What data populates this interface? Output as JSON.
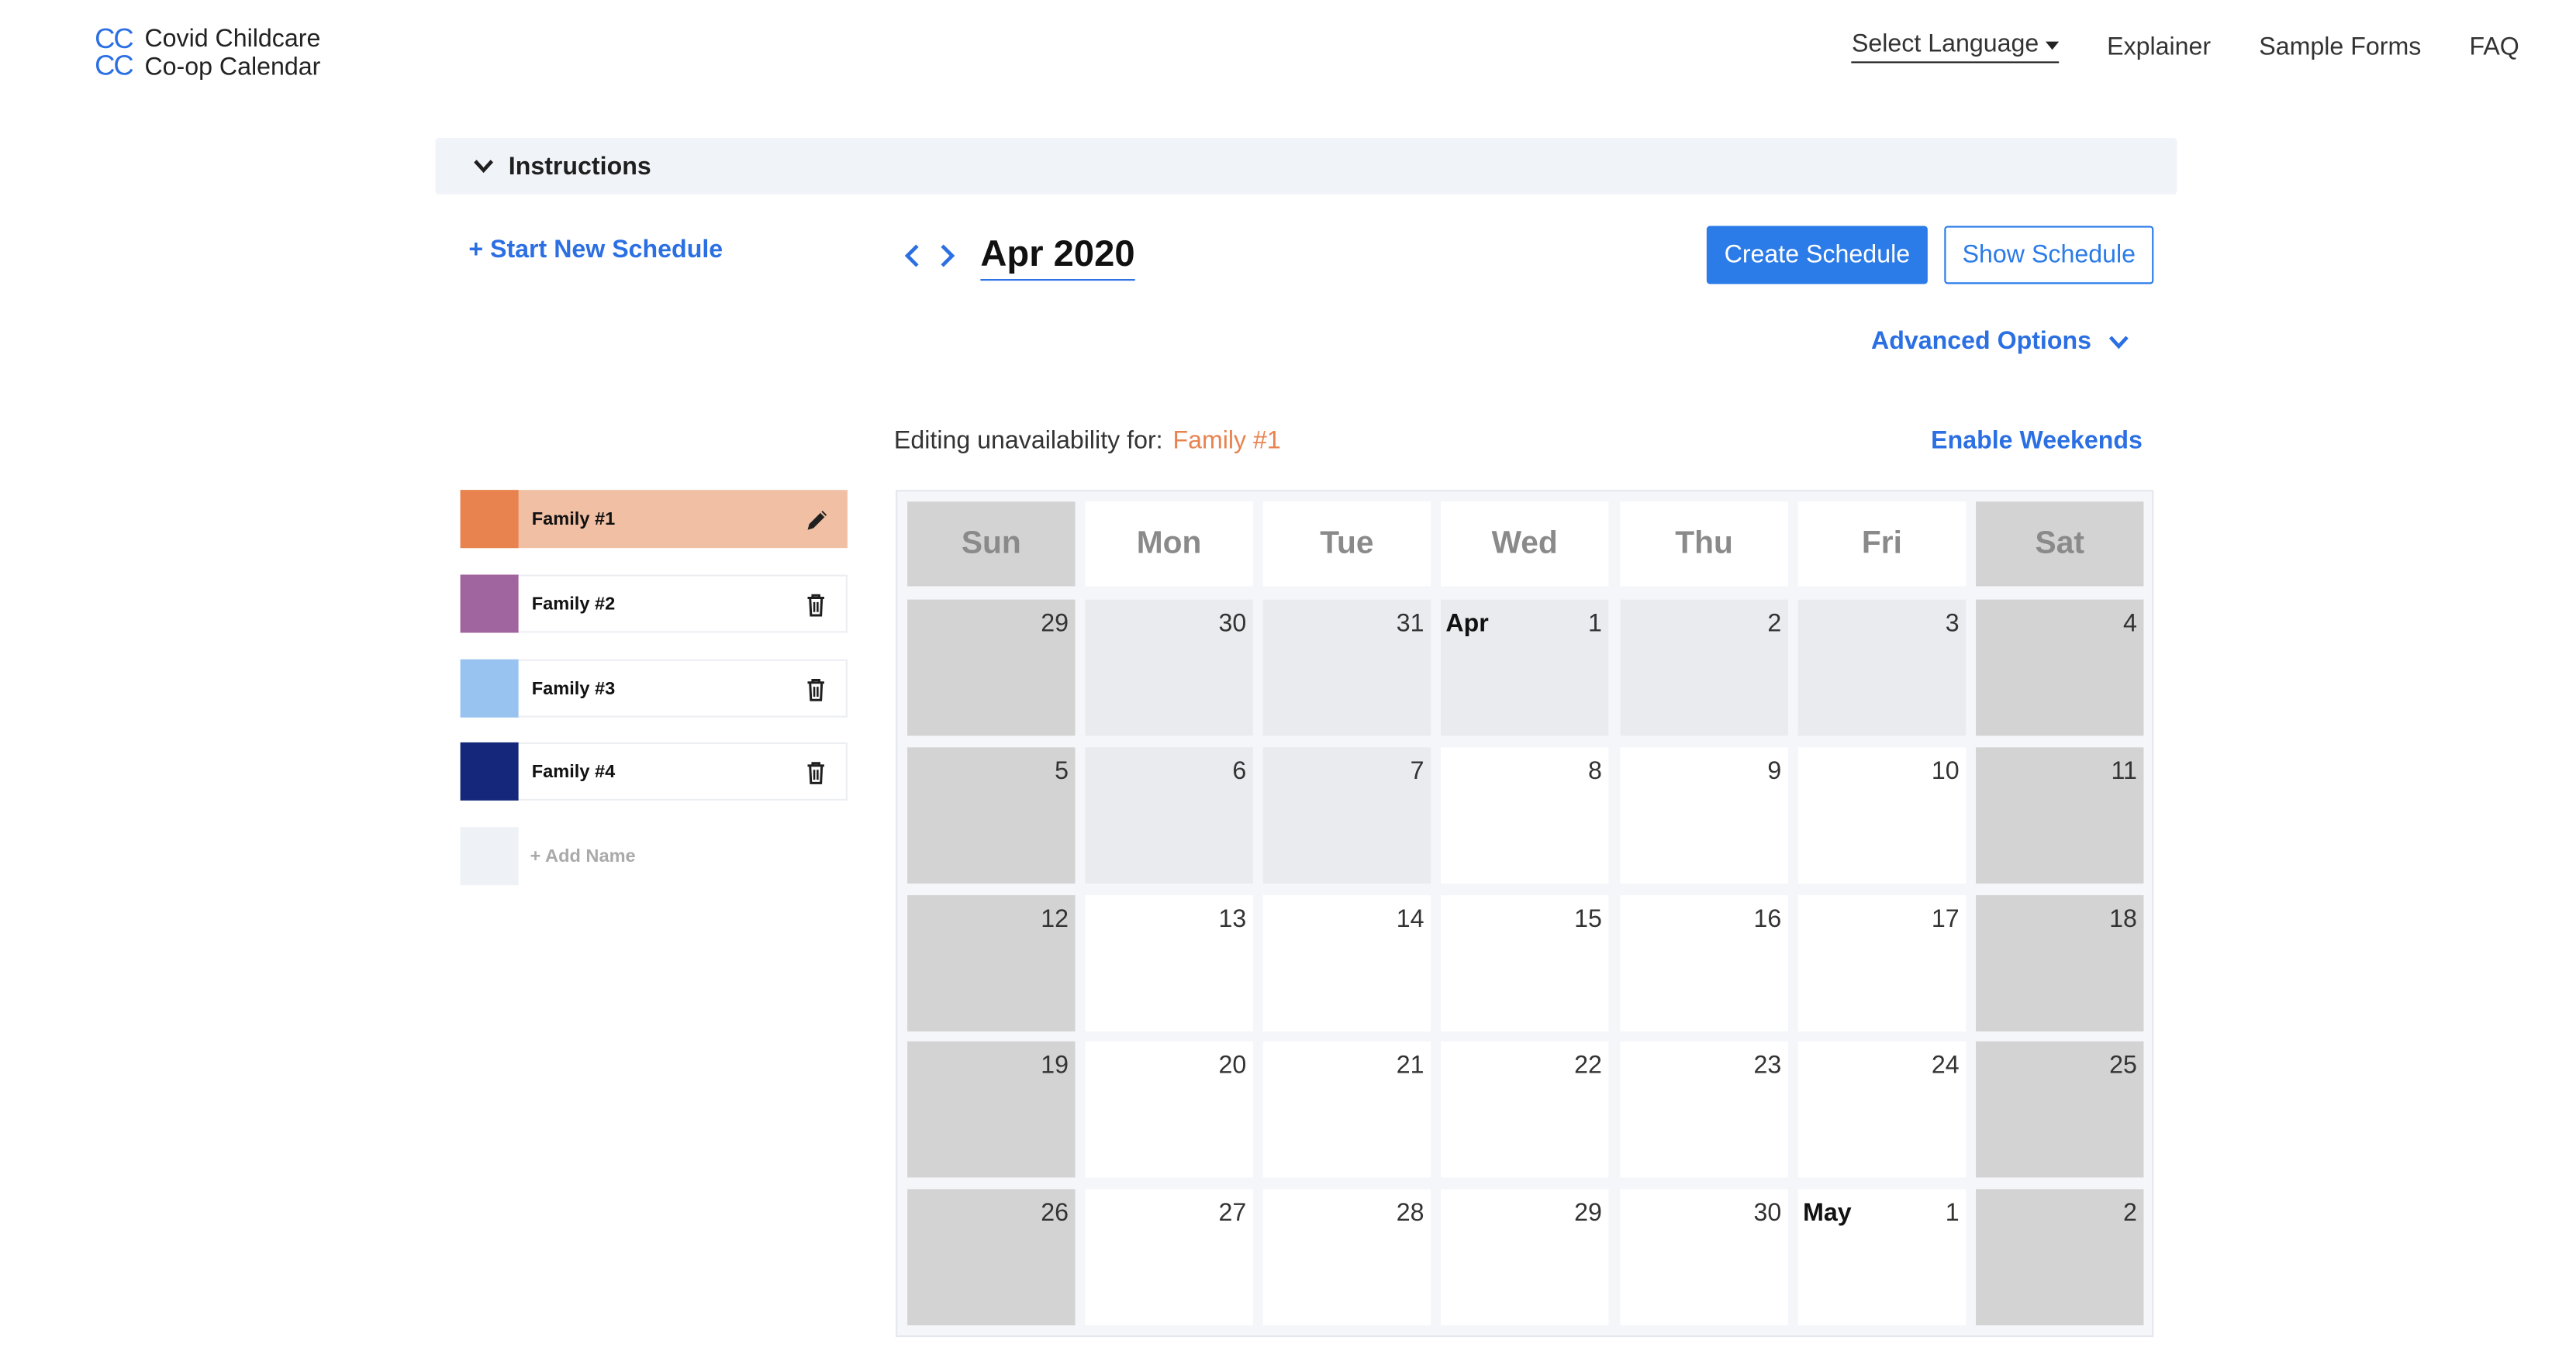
{
  "header": {
    "logo_mark_top": "CC",
    "logo_mark_bottom": "CC",
    "logo_line1": "Covid Childcare",
    "logo_line2": "Co-op Calendar",
    "nav": {
      "language": "Select Language",
      "explainer": "Explainer",
      "sample_forms": "Sample Forms",
      "faq": "FAQ"
    }
  },
  "instructions": {
    "label": "Instructions"
  },
  "toolbar": {
    "start_new": "+ Start New Schedule",
    "month_title": "Apr 2020",
    "create_schedule": "Create Schedule",
    "show_schedule": "Show Schedule",
    "advanced_options": "Advanced Options"
  },
  "editing": {
    "prefix": "Editing unavailability for:",
    "family": "Family #1",
    "enable_weekends": "Enable Weekends"
  },
  "families": [
    {
      "name": "Family #1",
      "color": "#e8834f",
      "row_color": "#f1bfa4",
      "selected": true,
      "icon": "pencil-icon"
    },
    {
      "name": "Family #2",
      "color": "#a0649e",
      "selected": false,
      "icon": "trash-icon"
    },
    {
      "name": "Family #3",
      "color": "#98c3f0",
      "selected": false,
      "icon": "trash-icon"
    },
    {
      "name": "Family #4",
      "color": "#15277a",
      "selected": false,
      "icon": "trash-icon"
    }
  ],
  "add_name": "+ Add Name",
  "calendar": {
    "day_headers": [
      "Sun",
      "Mon",
      "Tue",
      "Wed",
      "Thu",
      "Fri",
      "Sat"
    ],
    "weeks": [
      [
        {
          "d": "29",
          "s": "wk"
        },
        {
          "d": "30",
          "s": "un"
        },
        {
          "d": "31",
          "s": "un"
        },
        {
          "d": "1",
          "m": "Apr",
          "s": "un"
        },
        {
          "d": "2",
          "s": "un"
        },
        {
          "d": "3",
          "s": "un"
        },
        {
          "d": "4",
          "s": "wk"
        }
      ],
      [
        {
          "d": "5",
          "s": "wk"
        },
        {
          "d": "6",
          "s": "un"
        },
        {
          "d": "7",
          "s": "un"
        },
        {
          "d": "8",
          "s": "av"
        },
        {
          "d": "9",
          "s": "av"
        },
        {
          "d": "10",
          "s": "av"
        },
        {
          "d": "11",
          "s": "wk"
        }
      ],
      [
        {
          "d": "12",
          "s": "wk"
        },
        {
          "d": "13",
          "s": "av"
        },
        {
          "d": "14",
          "s": "av"
        },
        {
          "d": "15",
          "s": "av"
        },
        {
          "d": "16",
          "s": "av"
        },
        {
          "d": "17",
          "s": "av"
        },
        {
          "d": "18",
          "s": "wk"
        }
      ],
      [
        {
          "d": "19",
          "s": "wk"
        },
        {
          "d": "20",
          "s": "av"
        },
        {
          "d": "21",
          "s": "av"
        },
        {
          "d": "22",
          "s": "av"
        },
        {
          "d": "23",
          "s": "av"
        },
        {
          "d": "24",
          "s": "av"
        },
        {
          "d": "25",
          "s": "wk"
        }
      ],
      [
        {
          "d": "26",
          "s": "wk"
        },
        {
          "d": "27",
          "s": "av"
        },
        {
          "d": "28",
          "s": "av"
        },
        {
          "d": "29",
          "s": "av"
        },
        {
          "d": "30",
          "s": "av"
        },
        {
          "d": "1",
          "m": "May",
          "s": "av"
        },
        {
          "d": "2",
          "s": "wk"
        }
      ]
    ]
  }
}
